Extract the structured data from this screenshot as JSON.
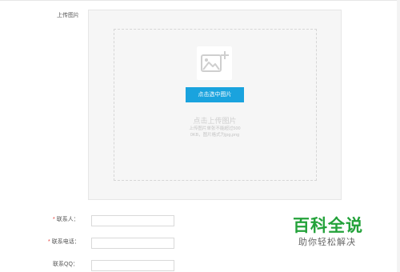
{
  "upload": {
    "label": "上传图片",
    "button_label": "点击选中图片",
    "hint_title": "点击上传图片",
    "hint_line1": "上传图片单张不能超过500",
    "hint_line2": "0KB，图片格式为jpg,png",
    "icon": "image-plus-icon"
  },
  "form": {
    "required_mark": "*",
    "contact_person": {
      "label": "联系人：",
      "value": ""
    },
    "contact_phone": {
      "label": "联系电话：",
      "value": ""
    },
    "contact_qq": {
      "label": "联系QQ：",
      "value": ""
    }
  },
  "watermark": {
    "title": "百科全说",
    "subtitle": "助你轻松解决"
  },
  "colors": {
    "button": "#1aa3de",
    "required": "#e53935",
    "watermark_green": "#23a23a"
  }
}
